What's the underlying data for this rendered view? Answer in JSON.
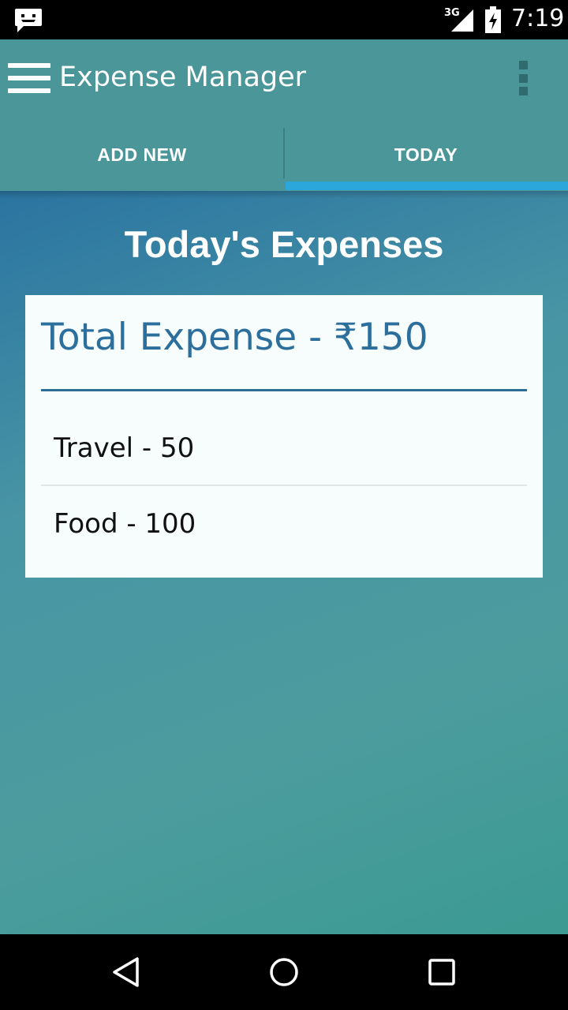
{
  "status_bar": {
    "network_label": "3G",
    "time": "7:19",
    "icons": [
      "notification-message-icon",
      "signal-icon",
      "battery-charging-icon"
    ]
  },
  "toolbar": {
    "title": "Expense Manager",
    "icons": [
      "menu-icon",
      "overflow-menu-icon"
    ]
  },
  "tabs": [
    {
      "label": "ADD NEW",
      "selected": false
    },
    {
      "label": "TODAY",
      "selected": true
    }
  ],
  "main": {
    "heading": "Today's Expenses",
    "total_label": "Total Expense - ₹150",
    "expenses": [
      {
        "label": "Travel - 50"
      },
      {
        "label": "Food - 100"
      }
    ]
  },
  "nav_bar": {
    "icons": [
      "back-icon",
      "home-icon",
      "recents-icon"
    ]
  },
  "colors": {
    "toolbar": "#4b9699",
    "tab_indicator": "#2ca7dc",
    "total_text": "#2c6f9c",
    "card_background": "#f7fdfd"
  }
}
